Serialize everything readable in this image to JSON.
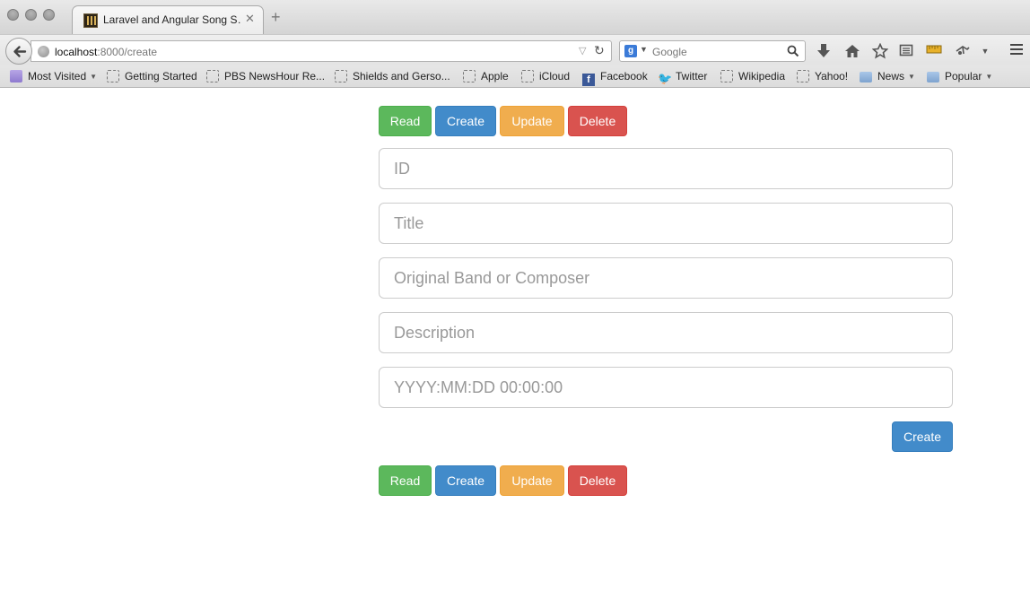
{
  "browser": {
    "tab": {
      "title": "Laravel and Angular Song S…",
      "close": "✕"
    },
    "new_tab": "+",
    "url": {
      "host": "localhost",
      "path": ":8000/create"
    },
    "search": {
      "engine_letter": "g",
      "placeholder": "Google"
    },
    "toolbar_icons": [
      "download-icon",
      "home-icon",
      "bookmark-star-icon",
      "reading-list-icon",
      "ruler-icon",
      "extension-icon",
      "menu-icon"
    ],
    "bookmarks": [
      {
        "label": "Most Visited",
        "icon": "smart-folder-icon",
        "dropdown": true
      },
      {
        "label": "Getting Started",
        "icon": "page-icon"
      },
      {
        "label": "PBS NewsHour Re...",
        "icon": "page-icon"
      },
      {
        "label": "Shields and Gerso...",
        "icon": "page-icon"
      },
      {
        "label": "Apple",
        "icon": "page-icon"
      },
      {
        "label": "iCloud",
        "icon": "page-icon"
      },
      {
        "label": "Facebook",
        "icon": "facebook-icon"
      },
      {
        "label": "Twitter",
        "icon": "twitter-icon"
      },
      {
        "label": "Wikipedia",
        "icon": "page-icon"
      },
      {
        "label": "Yahoo!",
        "icon": "page-icon"
      },
      {
        "label": "News",
        "icon": "folder-icon",
        "dropdown": true
      },
      {
        "label": "Popular",
        "icon": "folder-icon",
        "dropdown": true
      }
    ]
  },
  "nav_top": {
    "read": "Read",
    "create": "Create",
    "update": "Update",
    "delete": "Delete"
  },
  "form": {
    "id_placeholder": "ID",
    "title_placeholder": "Title",
    "band_placeholder": "Original Band or Composer",
    "description_placeholder": "Description",
    "date_placeholder": "YYYY:MM:DD 00:00:00",
    "submit_label": "Create"
  },
  "nav_bottom": {
    "read": "Read",
    "create": "Create",
    "update": "Update",
    "delete": "Delete"
  },
  "colors": {
    "read": "#5cb85c",
    "create": "#428bca",
    "update": "#f0ad4e",
    "delete": "#d9534f"
  }
}
